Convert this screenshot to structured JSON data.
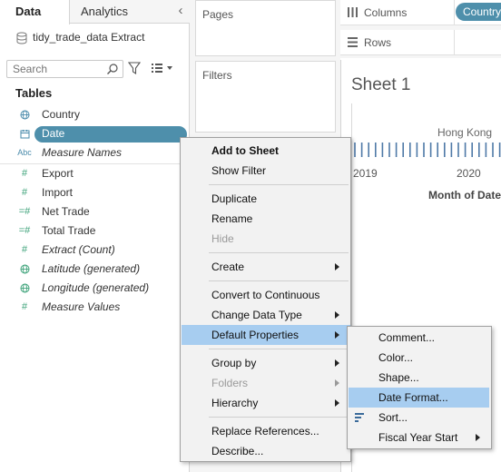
{
  "tabs": {
    "data": "Data",
    "analytics": "Analytics",
    "collapse": "‹"
  },
  "data_source": {
    "name": "tidy_trade_data Extract"
  },
  "search": {
    "placeholder": "Search"
  },
  "tables_heading": "Tables",
  "fields": [
    {
      "label": "Country",
      "icon": "globe-icon",
      "italic": false
    },
    {
      "label": "Date",
      "icon": "calendar-icon",
      "italic": false,
      "selected": true
    },
    {
      "label": "Measure Names",
      "icon": "abc-icon",
      "italic": true
    },
    {
      "label": "Export",
      "icon": "hash-icon",
      "italic": false
    },
    {
      "label": "Import",
      "icon": "hash-icon",
      "italic": false
    },
    {
      "label": "Net Trade",
      "icon": "calc-hash-icon",
      "italic": false
    },
    {
      "label": "Total Trade",
      "icon": "calc-hash-icon",
      "italic": false
    },
    {
      "label": "Extract (Count)",
      "icon": "hash-icon",
      "italic": true
    },
    {
      "label": "Latitude (generated)",
      "icon": "globe-icon",
      "italic": true
    },
    {
      "label": "Longitude (generated)",
      "icon": "globe-icon",
      "italic": true
    },
    {
      "label": "Measure Values",
      "icon": "hash-icon",
      "italic": true
    }
  ],
  "cards": {
    "pages": "Pages",
    "filters": "Filters"
  },
  "shelves": {
    "columns": "Columns",
    "rows": "Rows",
    "columns_pill": "Country"
  },
  "sheet": {
    "title": "Sheet 1",
    "header_label": "Hong Kong",
    "year_left": "2019",
    "year_right": "2020",
    "axis_title": "Month of Date"
  },
  "context_menu": {
    "items": [
      {
        "label": "Add to Sheet",
        "bold": true
      },
      {
        "label": "Show Filter"
      },
      {
        "label": "Duplicate"
      },
      {
        "label": "Rename"
      },
      {
        "label": "Hide",
        "disabled": true
      },
      {
        "label": "Create",
        "submenu": true
      },
      {
        "label": "Convert to Continuous"
      },
      {
        "label": "Change Data Type",
        "submenu": true
      },
      {
        "label": "Default Properties",
        "submenu": true,
        "highlighted": true
      },
      {
        "label": "Group by",
        "submenu": true
      },
      {
        "label": "Folders",
        "submenu": true,
        "disabled": true
      },
      {
        "label": "Hierarchy",
        "submenu": true
      },
      {
        "label": "Replace References..."
      },
      {
        "label": "Describe..."
      }
    ]
  },
  "submenu": {
    "items": [
      {
        "label": "Comment..."
      },
      {
        "label": "Color..."
      },
      {
        "label": "Shape..."
      },
      {
        "label": "Date Format...",
        "highlighted": true
      },
      {
        "label": "Sort...",
        "icon": "sort-icon"
      },
      {
        "label": "Fiscal Year Start",
        "submenu": true
      }
    ]
  },
  "colors": {
    "pill": "#4e8fab",
    "highlight": "#a7cdf0",
    "menu_bg": "#f2f2f2"
  }
}
